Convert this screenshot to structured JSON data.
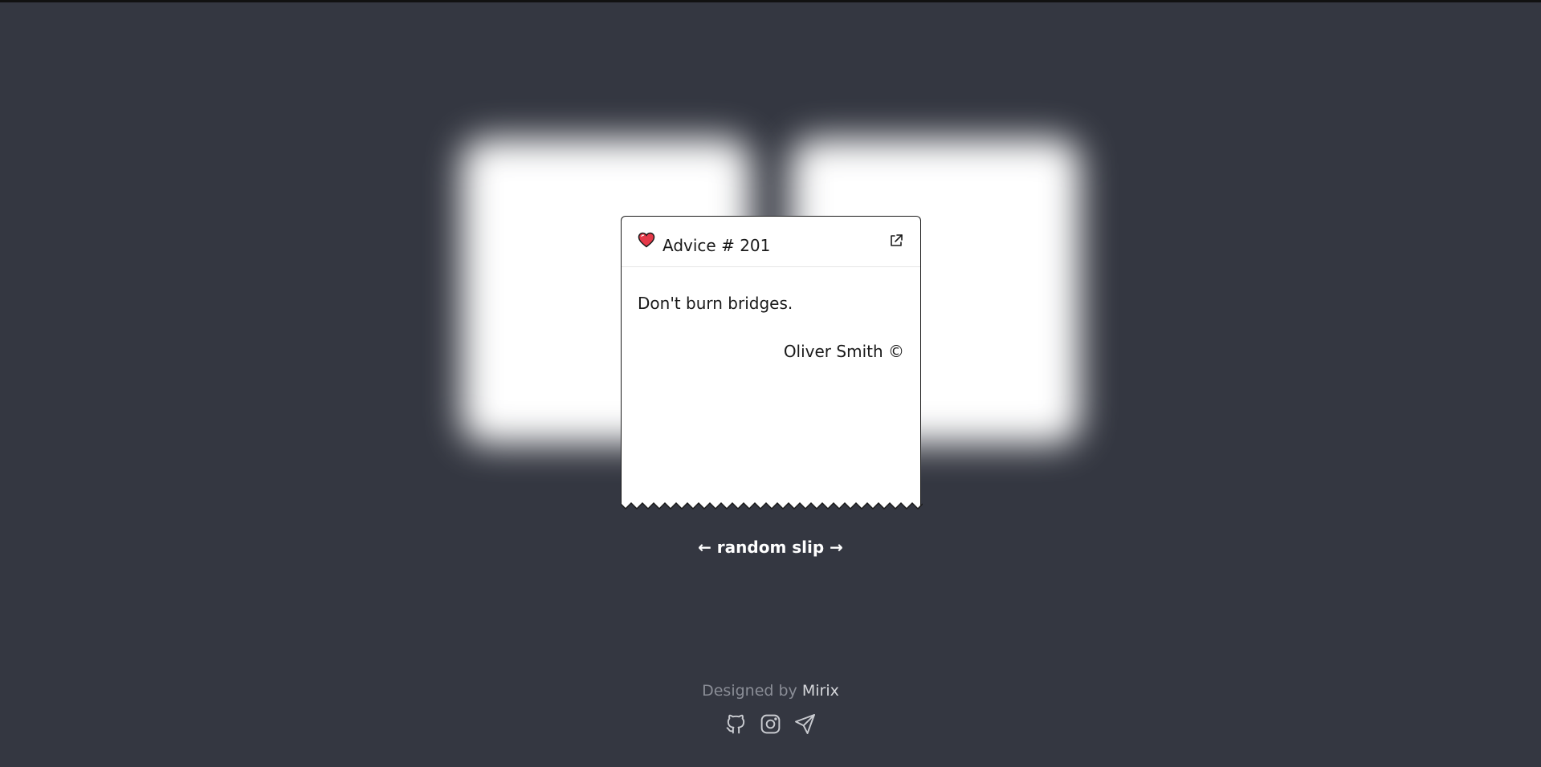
{
  "card": {
    "title": "Advice # 201",
    "advice": "Don't burn bridges.",
    "author": "Oliver Smith ©",
    "heart_color": "#e53949"
  },
  "random_slip": {
    "label": "← random slip →"
  },
  "footer": {
    "designed_by_prefix": "Designed by",
    "designer_name": "Mirix",
    "socials": [
      {
        "icon": "github-icon"
      },
      {
        "icon": "instagram-icon"
      },
      {
        "icon": "telegram-icon"
      }
    ]
  },
  "colors": {
    "background": "#343741",
    "card": "#ffffff",
    "text": "#1a1a1a",
    "footer_text": "#8a8d96"
  }
}
